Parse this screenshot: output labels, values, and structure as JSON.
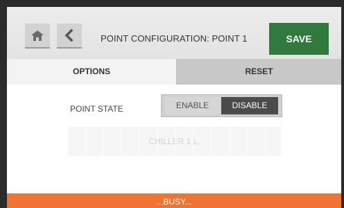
{
  "header": {
    "title": "POINT CONFIGURATION: POINT 1",
    "save_label": "SAVE",
    "home_icon": "home-icon",
    "back_icon": "chevron-left-icon"
  },
  "tabs": [
    {
      "label": "OPTIONS",
      "active": true
    },
    {
      "label": "RESET",
      "active": false
    }
  ],
  "point_state": {
    "label": "POINT STATE",
    "options": [
      "ENABLE",
      "DISABLE"
    ],
    "selected": "DISABLE"
  },
  "name_field": {
    "value": "CHILLER 1 L."
  },
  "status": {
    "text": "...BUSY..."
  },
  "colors": {
    "save_button": "#2f7a3c",
    "status_bar": "#ef7434",
    "selected_option": "#4b4b4b"
  }
}
